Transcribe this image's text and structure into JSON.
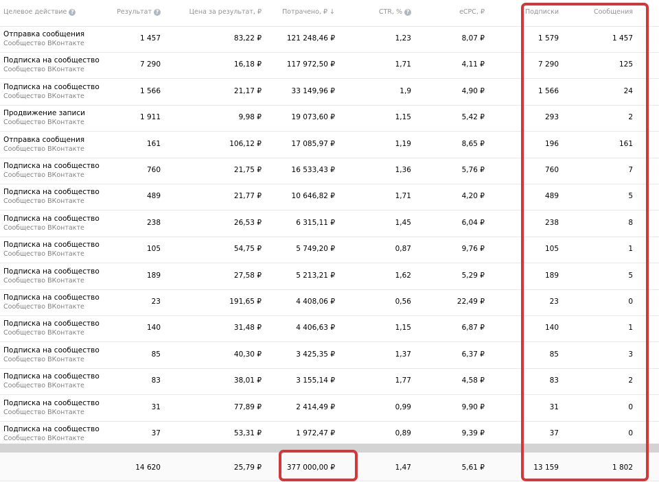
{
  "header": {
    "action": "Целевое действие",
    "result": "Результат",
    "cost_per_result": "Цена за результат, ₽",
    "spent": "Потрачено, ₽ ↓",
    "ctr": "CTR, %",
    "ecpc": "eCPC, ₽",
    "subscriptions": "Подписки",
    "messages": "Сообщения"
  },
  "rows": [
    {
      "title": "Отправка сообщения",
      "sub": "Сообщество ВКонтакте",
      "result": "1 457",
      "cpr": "83,22 ₽",
      "spent": "121 248,46 ₽",
      "ctr": "1,23",
      "ecpc": "8,07 ₽",
      "subs": "1 579",
      "msgs": "1 457"
    },
    {
      "title": "Подписка на сообщество",
      "sub": "Сообщество ВКонтакте",
      "result": "7 290",
      "cpr": "16,18 ₽",
      "spent": "117 972,50 ₽",
      "ctr": "1,71",
      "ecpc": "4,11 ₽",
      "subs": "7 290",
      "msgs": "125"
    },
    {
      "title": "Подписка на сообщество",
      "sub": "Сообщество ВКонтакте",
      "result": "1 566",
      "cpr": "21,17 ₽",
      "spent": "33 149,96 ₽",
      "ctr": "1,9",
      "ecpc": "4,90 ₽",
      "subs": "1 566",
      "msgs": "24"
    },
    {
      "title": "Продвижение записи",
      "sub": "Сообщество ВКонтакте",
      "result": "1 911",
      "cpr": "9,98 ₽",
      "spent": "19 073,60 ₽",
      "ctr": "1,15",
      "ecpc": "5,42 ₽",
      "subs": "293",
      "msgs": "2"
    },
    {
      "title": "Отправка сообщения",
      "sub": "Сообщество ВКонтакте",
      "result": "161",
      "cpr": "106,12 ₽",
      "spent": "17 085,97 ₽",
      "ctr": "1,19",
      "ecpc": "8,65 ₽",
      "subs": "196",
      "msgs": "161"
    },
    {
      "title": "Подписка на сообщество",
      "sub": "Сообщество ВКонтакте",
      "result": "760",
      "cpr": "21,75 ₽",
      "spent": "16 533,43 ₽",
      "ctr": "1,36",
      "ecpc": "5,76 ₽",
      "subs": "760",
      "msgs": "7"
    },
    {
      "title": "Подписка на сообщество",
      "sub": "Сообщество ВКонтакте",
      "result": "489",
      "cpr": "21,77 ₽",
      "spent": "10 646,82 ₽",
      "ctr": "1,71",
      "ecpc": "4,20 ₽",
      "subs": "489",
      "msgs": "5"
    },
    {
      "title": "Подписка на сообщество",
      "sub": "Сообщество ВКонтакте",
      "result": "238",
      "cpr": "26,53 ₽",
      "spent": "6 315,11 ₽",
      "ctr": "1,45",
      "ecpc": "6,04 ₽",
      "subs": "238",
      "msgs": "8"
    },
    {
      "title": "Подписка на сообщество",
      "sub": "Сообщество ВКонтакте",
      "result": "105",
      "cpr": "54,75 ₽",
      "spent": "5 749,20 ₽",
      "ctr": "0,87",
      "ecpc": "9,76 ₽",
      "subs": "105",
      "msgs": "1"
    },
    {
      "title": "Подписка на сообщество",
      "sub": "Сообщество ВКонтакте",
      "result": "189",
      "cpr": "27,58 ₽",
      "spent": "5 213,21 ₽",
      "ctr": "1,62",
      "ecpc": "5,29 ₽",
      "subs": "189",
      "msgs": "5"
    },
    {
      "title": "Подписка на сообщество",
      "sub": "Сообщество ВКонтакте",
      "result": "23",
      "cpr": "191,65 ₽",
      "spent": "4 408,06 ₽",
      "ctr": "0,56",
      "ecpc": "22,49 ₽",
      "subs": "23",
      "msgs": "0"
    },
    {
      "title": "Подписка на сообщество",
      "sub": "Сообщество ВКонтакте",
      "result": "140",
      "cpr": "31,48 ₽",
      "spent": "4 406,63 ₽",
      "ctr": "1,15",
      "ecpc": "6,87 ₽",
      "subs": "140",
      "msgs": "1"
    },
    {
      "title": "Подписка на сообщество",
      "sub": "Сообщество ВКонтакте",
      "result": "85",
      "cpr": "40,30 ₽",
      "spent": "3 425,35 ₽",
      "ctr": "1,37",
      "ecpc": "6,37 ₽",
      "subs": "85",
      "msgs": "3"
    },
    {
      "title": "Подписка на сообщество",
      "sub": "Сообщество ВКонтакте",
      "result": "83",
      "cpr": "38,01 ₽",
      "spent": "3 155,14 ₽",
      "ctr": "1,77",
      "ecpc": "4,58 ₽",
      "subs": "83",
      "msgs": "2"
    },
    {
      "title": "Подписка на сообщество",
      "sub": "Сообщество ВКонтакте",
      "result": "31",
      "cpr": "77,89 ₽",
      "spent": "2 414,49 ₽",
      "ctr": "0,99",
      "ecpc": "9,90 ₽",
      "subs": "31",
      "msgs": "0"
    },
    {
      "title": "Подписка на сообщество",
      "sub": "Сообщество ВКонтакте",
      "result": "37",
      "cpr": "53,31 ₽",
      "spent": "1 972,47 ₽",
      "ctr": "0,89",
      "ecpc": "9,39 ₽",
      "subs": "37",
      "msgs": "0"
    }
  ],
  "totals": {
    "result": "14 620",
    "cpr": "25,79 ₽",
    "spent": "377 000,00 ₽",
    "ctr": "1,47",
    "ecpc": "5,61 ₽",
    "subs": "13 159",
    "msgs": "1 802"
  },
  "colors": {
    "highlight": "#d0393a",
    "header_text": "#939393",
    "subtext": "#828282",
    "separator_band": "#d3d3d3"
  },
  "icons": {
    "help": "question-circle-icon"
  }
}
